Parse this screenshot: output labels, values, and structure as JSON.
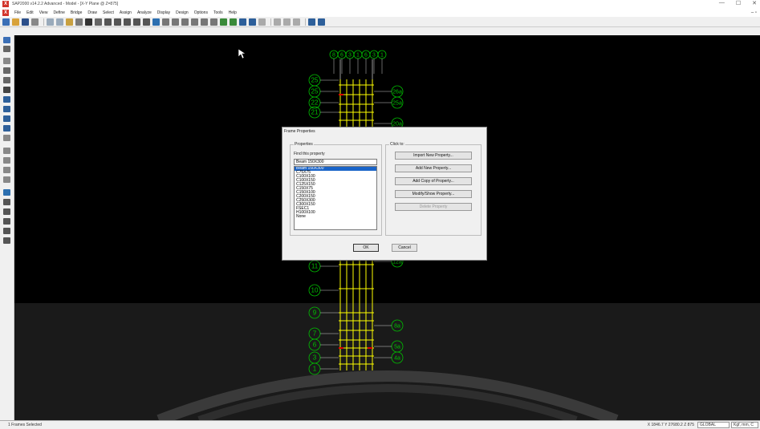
{
  "window": {
    "title": "SAP2000 v14.2.2 Advanced - Model - [X-Y Plane @ Z=875]",
    "controls": [
      "—",
      "☐",
      "✕"
    ]
  },
  "menubar": {
    "items": [
      "File",
      "Edit",
      "View",
      "Define",
      "Bridge",
      "Draw",
      "Select",
      "Assign",
      "Analyze",
      "Display",
      "Design",
      "Options",
      "Tools",
      "Help"
    ],
    "mdi_controls": "– ▫"
  },
  "drawing": {
    "top_bubbles": [
      "8",
      "6",
      "3",
      "1",
      "6",
      "3",
      "1"
    ],
    "left_bubbles": [
      "25",
      "25",
      "22",
      "21",
      "11",
      "10",
      "9",
      "7",
      "6",
      "3",
      "1"
    ],
    "right_bubbles": [
      "26a",
      "25a",
      "20a",
      "12a",
      "8a",
      "5a",
      "4a"
    ]
  },
  "dialog": {
    "title": "Frame Properties",
    "properties_group": "Properties",
    "find_label": "Find this property",
    "find_value": "Beam 150X300",
    "properties": [
      "Beam 150X300",
      "C75X75",
      "C100X100",
      "C100X150",
      "C125X150",
      "C150X75",
      "C150X100",
      "C200X150",
      "C250X300",
      "C300X150",
      "FSEC1",
      "H100X100",
      "None"
    ],
    "selected_index": 0,
    "click_group": "Click to:",
    "buttons": {
      "import": "Import New Property...",
      "add": "Add New Property...",
      "add_copy": "Add Copy of Property...",
      "modify": "Modify/Show Property...",
      "delete": "Delete Property"
    },
    "ok": "OK",
    "cancel": "Cancel"
  },
  "status": {
    "left": "1 Frames Selected",
    "coords": "X 1846.7  Y 27680.2  Z 875",
    "coord_system": "GLOBAL",
    "units": "Kgf, mm, C"
  },
  "colors": {
    "canvas": "#000000",
    "bubble": "#00c000",
    "frame": "#ffff00",
    "selection": "#1a64c8"
  }
}
